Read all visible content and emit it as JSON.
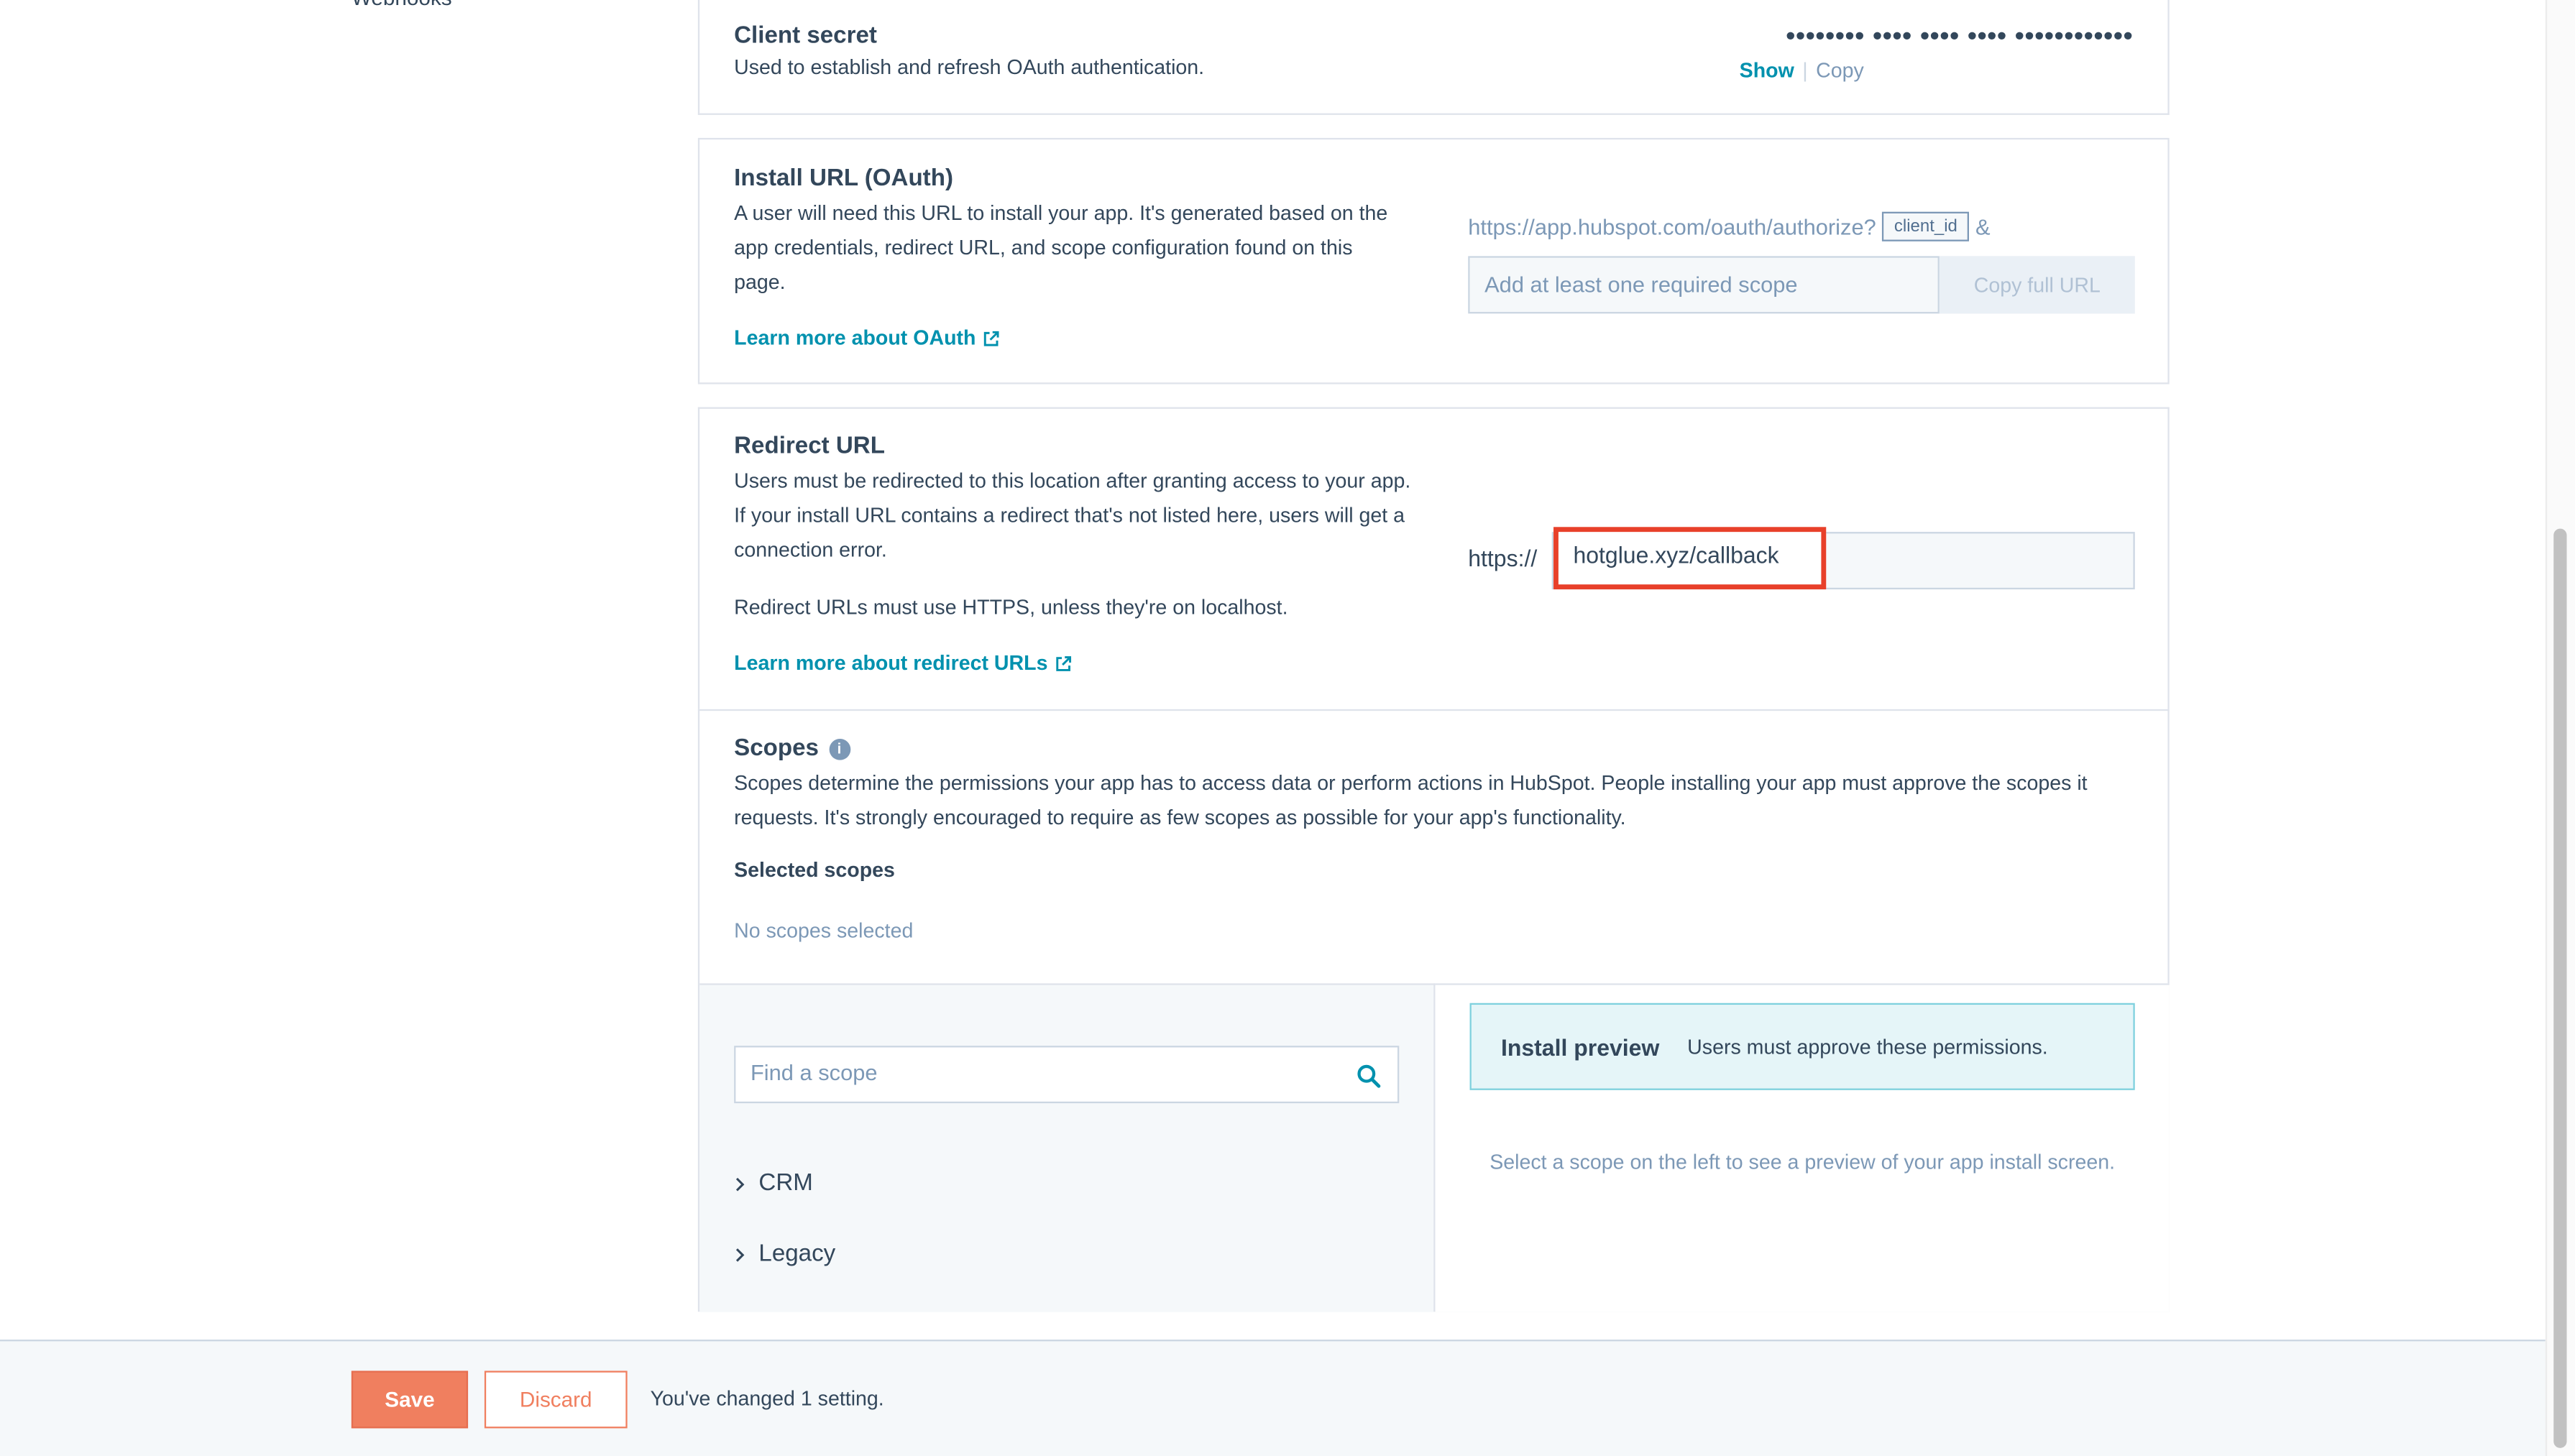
{
  "sidebar": {
    "cut_item": "Webhooks"
  },
  "client_secret": {
    "title": "Client secret",
    "description": "Used to establish and refresh OAuth authentication.",
    "masked_value": "•••••••• •••• •••• •••• ••••••••••••",
    "show_label": "Show",
    "separator": "|",
    "copy_label": "Copy"
  },
  "install_url": {
    "title": "Install URL (OAuth)",
    "description": "A user will need this URL to install your app. It's generated based on the app credentials, redirect URL, and scope configuration found on this page.",
    "link_label": "Learn more about OAuth",
    "base_url": "https://app.hubspot.com/oauth/authorize?",
    "chip_label": "client_id",
    "ampersand": "&",
    "scope_placeholder": "Add at least one required scope",
    "copy_full_label": "Copy full URL"
  },
  "redirect_url": {
    "title": "Redirect URL",
    "description": "Users must be redirected to this location after granting access to your app. If your install URL contains a redirect that's not listed here, users will get a connection error.",
    "note": "Redirect URLs must use HTTPS, unless they're on localhost.",
    "link_label": "Learn more about redirect URLs",
    "prefix": "https://",
    "value": "hotglue.xyz/callback",
    "highlight_color": "#e8402a"
  },
  "scopes": {
    "title": "Scopes",
    "info_glyph": "i",
    "description": "Scopes determine the permissions your app has to access data or perform actions in HubSpot. People installing your app must approve the scopes it requests. It's strongly encouraged to require as few scopes as possible for your app's functionality.",
    "selected_title": "Selected scopes",
    "none_selected": "No scopes selected",
    "search_placeholder": "Find a scope",
    "tree": [
      "CRM",
      "Legacy"
    ],
    "preview_title": "Install preview",
    "preview_subtitle": "Users must approve these permissions.",
    "preview_hint": "Select a scope on the left to see a preview of your app install screen."
  },
  "footer": {
    "save_label": "Save",
    "discard_label": "Discard",
    "status": "You've changed 1 setting.",
    "accent_color": "#f07f5f"
  }
}
